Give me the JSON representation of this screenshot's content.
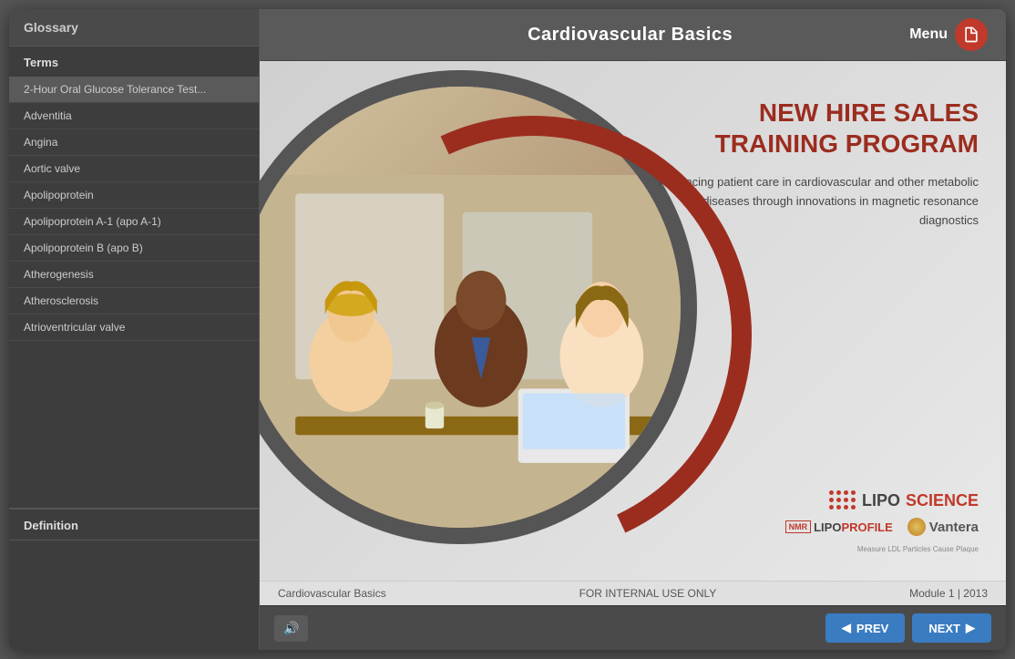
{
  "sidebar": {
    "header": "Glossary",
    "terms_label": "Terms",
    "definition_label": "Definition",
    "terms": [
      "2-Hour Oral Glucose Tolerance Test...",
      "Adventitia",
      "Angina",
      "Aortic valve",
      "Apolipoprotein",
      "Apolipoprotein A-1 (apo A-1)",
      "Apolipoprotein B (apo B)",
      "Atherogenesis",
      "Atherosclerosis",
      "Atrioventricular valve"
    ]
  },
  "header": {
    "title": "Cardiovascular Basics",
    "menu_label": "Menu"
  },
  "slide": {
    "main_title_line1": "NEW HIRE SALES",
    "main_title_line2": "TRAINING PROGRAM",
    "subtitle": "Advancing patient care in cardiovascular and other metabolic diseases through innovations in magnetic resonance diagnostics",
    "logo_lipo": "LIPO",
    "logo_science": "SCIENCE",
    "logo_nmr": "NMR",
    "logo_lipoprofile_lipo": "LIPO",
    "logo_lipoprofile_profile": "PROFILE",
    "logo_vantera": "Vantera",
    "logo_tagline": "Measure LDL Particles Cause Plaque"
  },
  "bottom_bar": {
    "left": "Cardiovascular Basics",
    "center": "FOR INTERNAL USE ONLY",
    "right": "Module 1 | 2013"
  },
  "nav": {
    "audio_icon": "🔊",
    "prev_label": "PREV",
    "next_label": "NEXT",
    "prev_arrow": "◀",
    "next_arrow": "▶"
  }
}
